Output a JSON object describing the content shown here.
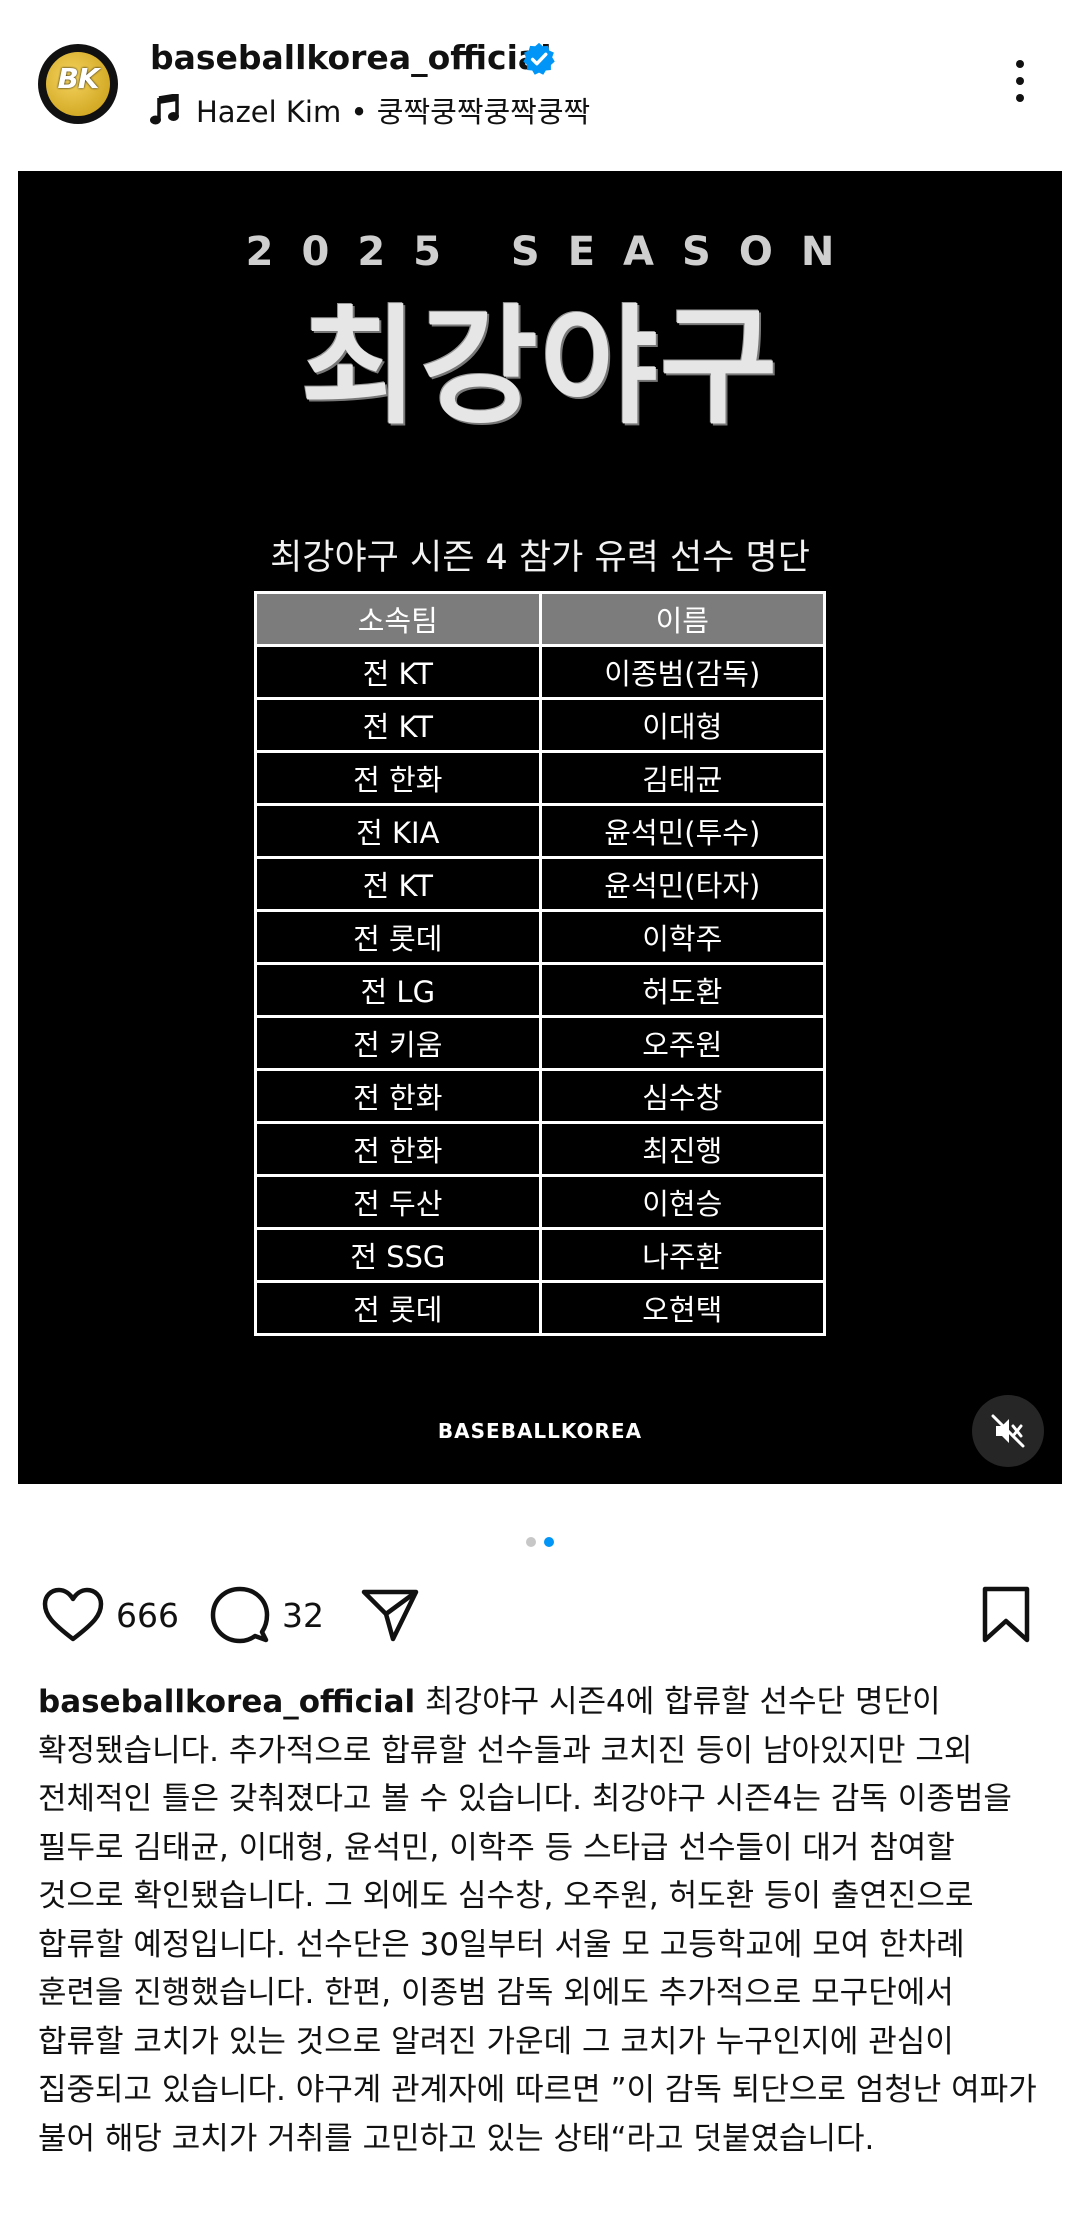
{
  "post": {
    "username": "baseballkorea_official",
    "avatar_text": "BK",
    "music": "Hazel Kim • 쿵짝쿵짝쿵짝쿵짝",
    "verified": true
  },
  "media": {
    "season_label": "2025 SEASON",
    "title": "최강야구",
    "table_caption": "최강야구 시즌 4 참가 유력 선수 명단",
    "table_headers": [
      "소속팀",
      "이름"
    ],
    "table_rows": [
      [
        "전 KT",
        "이종범(감독)"
      ],
      [
        "전 KT",
        "이대형"
      ],
      [
        "전 한화",
        "김태균"
      ],
      [
        "전 KIA",
        "윤석민(투수)"
      ],
      [
        "전 KT",
        "윤석민(타자)"
      ],
      [
        "전 롯데",
        "이학주"
      ],
      [
        "전 LG",
        "허도환"
      ],
      [
        "전 키움",
        "오주원"
      ],
      [
        "전 한화",
        "심수창"
      ],
      [
        "전 한화",
        "최진행"
      ],
      [
        "전 두산",
        "이현승"
      ],
      [
        "전 SSG",
        "나주환"
      ],
      [
        "전 롯데",
        "오현택"
      ]
    ],
    "brand": "BASEBALLKOREA",
    "mute_icon": "speaker-muted-icon"
  },
  "carousel": {
    "total": 2,
    "active_index": 1
  },
  "actions": {
    "likes": "666",
    "comments": "32"
  },
  "caption": {
    "username": "baseballkorea_official",
    "text": "최강야구 시즌4에 합류할 선수단 명단이 확정됐습니다. 추가적으로 합류할 선수들과 코치진 등이 남아있지만 그외 전체적인 틀은 갖춰졌다고 볼 수 있습니다. 최강야구 시즌4는 감독 이종범을 필두로 김태균, 이대형, 윤석민, 이학주 등 스타급 선수들이 대거 참여할 것으로 확인됐습니다. 그 외에도 심수창, 오주원, 허도환 등이 출연진으로 합류할 예정입니다. 선수단은 30일부터 서울 모 고등학교에 모여 한차례 훈련을 진행했습니다. 한편, 이종범 감독 외에도 추가적으로 모구단에서 합류할 코치가 있는 것으로 알려진 가운데 그 코치가 누구인지에 관심이 집중되고 있습니다. 야구계 관계자에 따르면 ”이 감독 퇴단으로 엄청난 여파가 불어 해당 코치가 거취를 고민하고 있는 상태“라고 덧붙였습니다."
  },
  "colors": {
    "accent": "#0095f6",
    "verified": "#0095f6",
    "table_header": "#7c7c7c"
  }
}
